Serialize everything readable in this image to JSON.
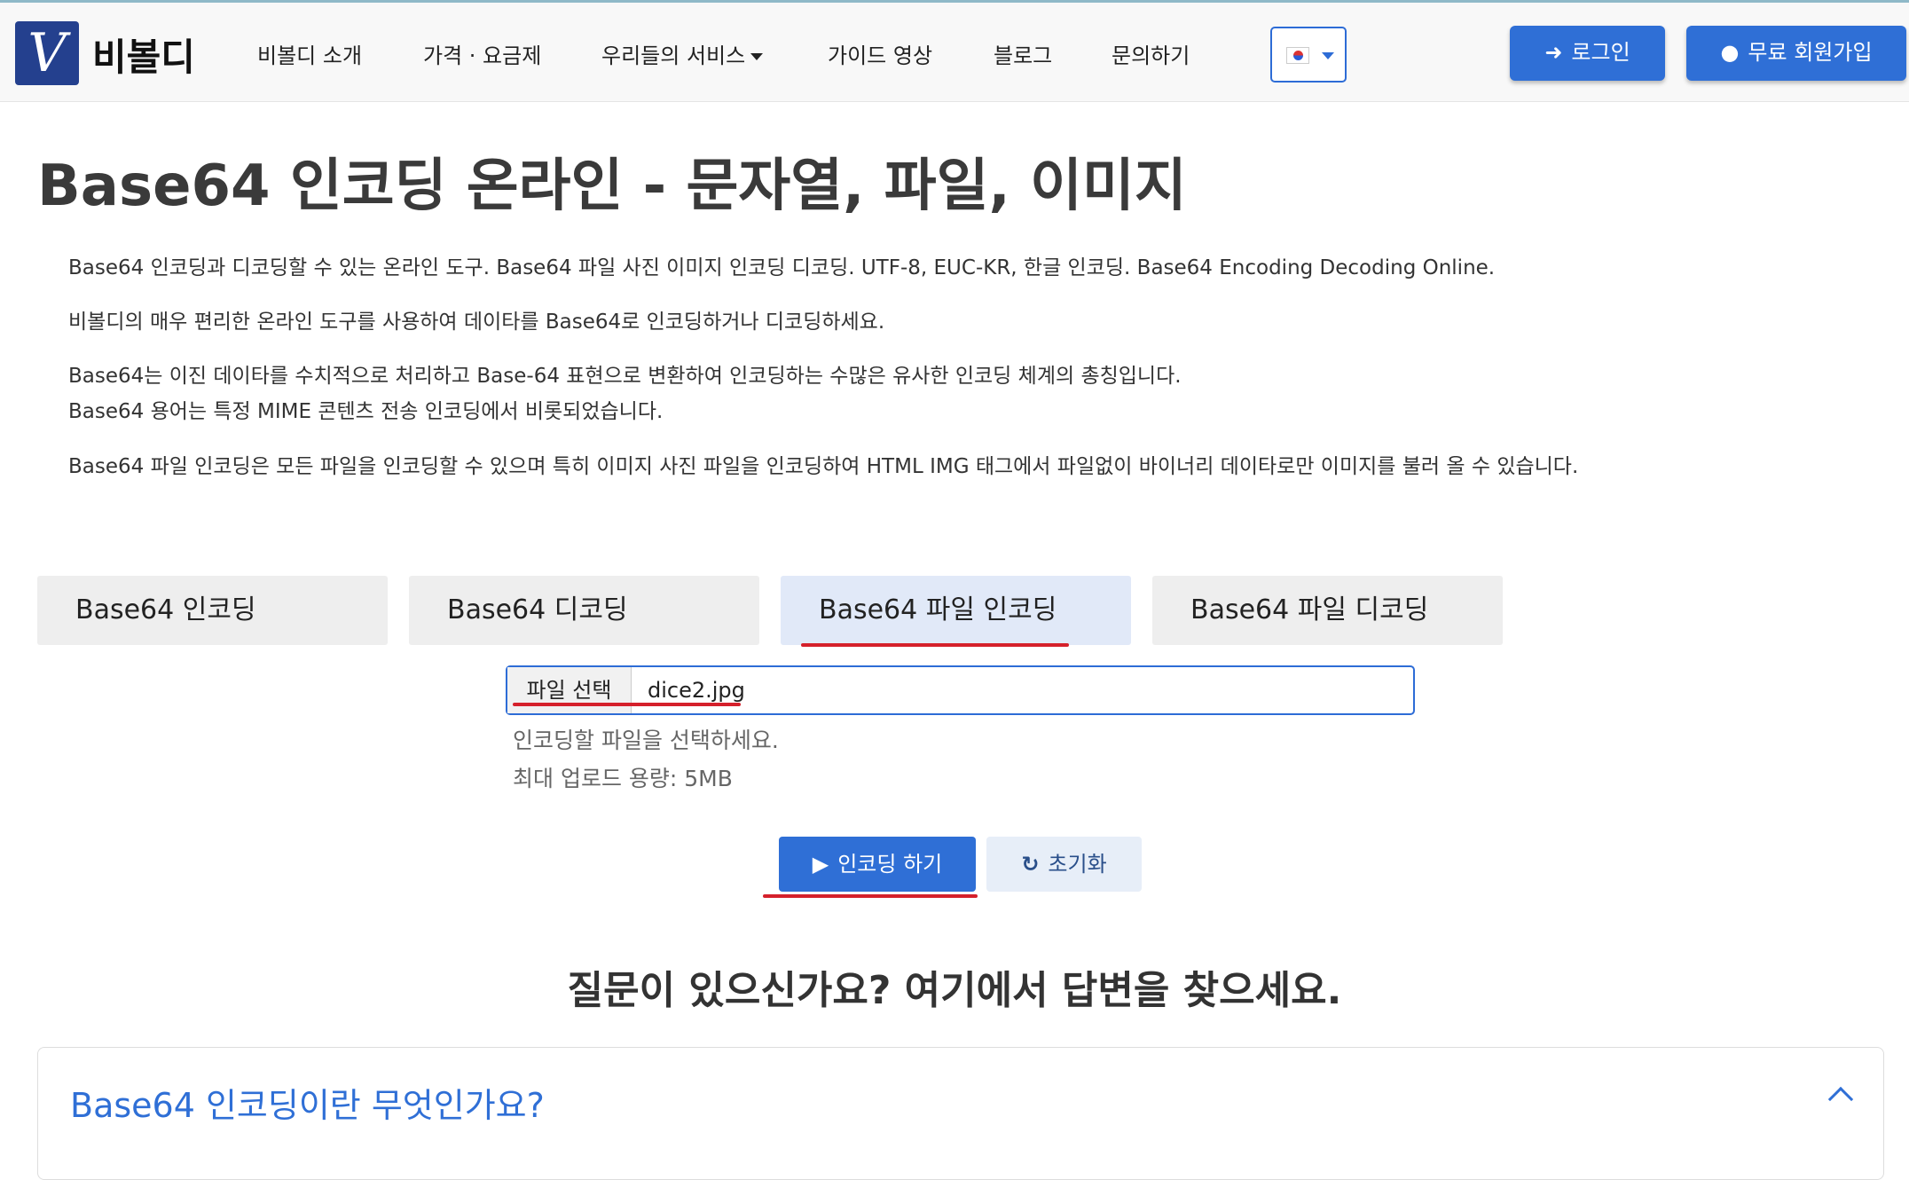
{
  "brand": {
    "logo_letter": "V",
    "name": "비볼디"
  },
  "nav": {
    "items": [
      "비볼디 소개",
      "가격 · 요금제",
      "우리들의 서비스",
      "가이드 영상",
      "블로그",
      "문의하기"
    ]
  },
  "header_buttons": {
    "login": "로그인",
    "signup": "무료 회원가입"
  },
  "page": {
    "title": "Base64 인코딩 온라인 - 문자열, 파일, 이미지",
    "descriptions": [
      "Base64 인코딩과 디코딩할 수 있는 온라인 도구. Base64 파일 사진 이미지 인코딩 디코딩. UTF-8, EUC-KR, 한글 인코딩. Base64 Encoding Decoding Online.",
      "비볼디의 매우 편리한 온라인 도구를 사용하여 데이타를 Base64로 인코딩하거나 디코딩하세요.",
      "Base64는 이진 데이타를 수치적으로 처리하고 Base-64 표현으로 변환하여 인코딩하는 수많은 유사한 인코딩 체계의 총칭입니다.",
      "Base64 용어는 특정 MIME 콘텐츠 전송 인코딩에서 비롯되었습니다.",
      "Base64 파일 인코딩은 모든 파일을 인코딩할 수 있으며 특히 이미지 사진 파일을 인코딩하여 HTML IMG 태그에서 파일없이 바이너리 데이타로만 이미지를 불러 올 수 있습니다."
    ]
  },
  "tabs": [
    "Base64 인코딩",
    "Base64 디코딩",
    "Base64 파일 인코딩",
    "Base64 파일 디코딩"
  ],
  "active_tab_index": 2,
  "file": {
    "button_label": "파일 선택",
    "selected_name": "dice2.jpg",
    "hint": "인코딩할 파일을 선택하세요.",
    "limit": "최대 업로드 용량: 5MB"
  },
  "actions": {
    "encode": "인코딩 하기",
    "reset": "초기화"
  },
  "faq": {
    "heading": "질문이 있으신가요? 여기에서 답변을 찾으세요.",
    "question": "Base64 인코딩이란 무엇인가요?"
  },
  "colors": {
    "primary": "#2f6fd6",
    "annotation_red": "#d5202b",
    "logo_bg": "#24408e"
  }
}
